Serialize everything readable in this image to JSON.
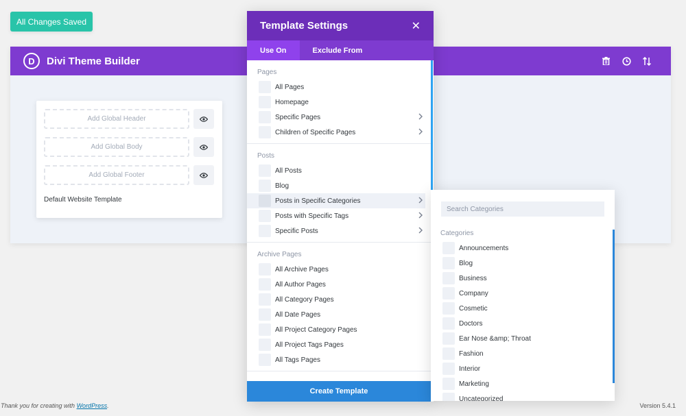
{
  "save_status": "All Changes Saved",
  "builder": {
    "title": "Divi Theme Builder",
    "logo_letter": "D",
    "icons": [
      "trash-icon",
      "history-icon",
      "sort-icon"
    ],
    "template": {
      "slots": [
        {
          "label": "Add Global Header"
        },
        {
          "label": "Add Global Body"
        },
        {
          "label": "Add Global Footer"
        }
      ],
      "name": "Default Website Template"
    }
  },
  "modal": {
    "title": "Template Settings",
    "close_glyph": "✕",
    "tabs": [
      {
        "label": "Use On",
        "active": true
      },
      {
        "label": "Exclude From",
        "active": false
      }
    ],
    "sections": [
      {
        "title": "Pages",
        "items": [
          {
            "label": "All Pages",
            "arrow": false
          },
          {
            "label": "Homepage",
            "arrow": false
          },
          {
            "label": "Specific Pages",
            "arrow": true
          },
          {
            "label": "Children of Specific Pages",
            "arrow": true
          }
        ]
      },
      {
        "title": "Posts",
        "items": [
          {
            "label": "All Posts",
            "arrow": false
          },
          {
            "label": "Blog",
            "arrow": false
          },
          {
            "label": "Posts in Specific Categories",
            "arrow": true,
            "highlight": true
          },
          {
            "label": "Posts with Specific Tags",
            "arrow": true
          },
          {
            "label": "Specific Posts",
            "arrow": true
          }
        ]
      },
      {
        "title": "Archive Pages",
        "items": [
          {
            "label": "All Archive Pages",
            "arrow": false
          },
          {
            "label": "All Author Pages",
            "arrow": false
          },
          {
            "label": "All Category Pages",
            "arrow": false
          },
          {
            "label": "All Date Pages",
            "arrow": false
          },
          {
            "label": "All Project Category Pages",
            "arrow": false
          },
          {
            "label": "All Project Tags Pages",
            "arrow": false
          },
          {
            "label": "All Tags Pages",
            "arrow": false
          }
        ]
      }
    ],
    "create_label": "Create Template"
  },
  "categories": {
    "search_placeholder": "Search Categories",
    "title": "Categories",
    "items": [
      "Announcements",
      "Blog",
      "Business",
      "Company",
      "Cosmetic",
      "Doctors",
      "Ear Nose &amp; Throat",
      "Fashion",
      "Interior",
      "Marketing",
      "Uncategorized"
    ]
  },
  "footer": {
    "thanks_prefix": "Thank you for creating with ",
    "thanks_link": "WordPress",
    "thanks_suffix": ".",
    "version": "Version 5.4.1"
  },
  "colors": {
    "accent_green": "#29c4a9",
    "purple": "#7e3bd0",
    "purple_dark": "#6c2eb9",
    "blue": "#2b87da"
  }
}
